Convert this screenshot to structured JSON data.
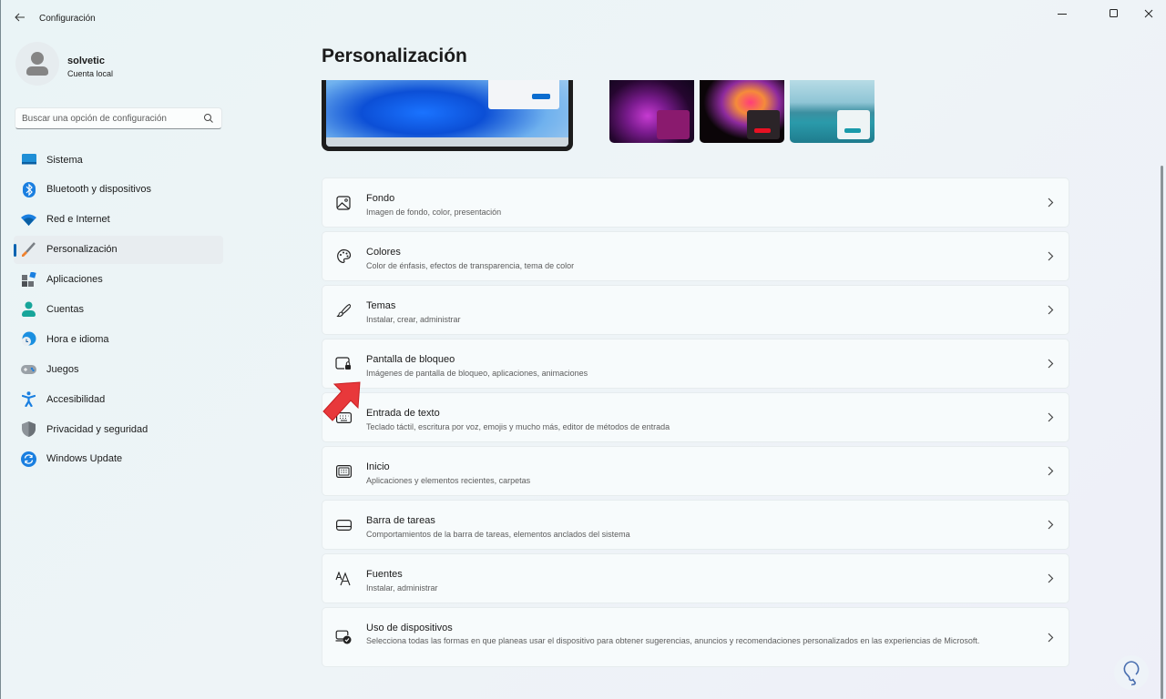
{
  "window": {
    "title": "Configuración",
    "controls": {
      "minimize": "minimize-icon",
      "maximize": "maximize-icon",
      "close": "close-icon"
    }
  },
  "profile": {
    "name": "solvetic",
    "account_type": "Cuenta local"
  },
  "search": {
    "placeholder": "Buscar una opción de configuración",
    "value": ""
  },
  "sidebar": {
    "active_index": 3,
    "accent_color": "#0063b1",
    "items": [
      {
        "label": "Sistema",
        "icon": "monitor-icon"
      },
      {
        "label": "Bluetooth y dispositivos",
        "icon": "bluetooth-icon"
      },
      {
        "label": "Red e Internet",
        "icon": "wifi-icon"
      },
      {
        "label": "Personalización",
        "icon": "paintbrush-icon"
      },
      {
        "label": "Aplicaciones",
        "icon": "apps-icon"
      },
      {
        "label": "Cuentas",
        "icon": "person-icon"
      },
      {
        "label": "Hora e idioma",
        "icon": "globe-clock-icon"
      },
      {
        "label": "Juegos",
        "icon": "gamepad-icon"
      },
      {
        "label": "Accesibilidad",
        "icon": "accessibility-icon"
      },
      {
        "label": "Privacidad y seguridad",
        "icon": "shield-icon"
      },
      {
        "label": "Windows Update",
        "icon": "update-icon"
      }
    ]
  },
  "main": {
    "title": "Personalización",
    "themes": [
      {
        "name": "theme-1",
        "selected": true
      },
      {
        "name": "theme-2",
        "selected": false
      },
      {
        "name": "theme-3",
        "selected": false
      },
      {
        "name": "theme-4",
        "selected": false,
        "button_color": "#8a1a6e"
      },
      {
        "name": "theme-5",
        "selected": false,
        "button_color": "#e81123"
      },
      {
        "name": "theme-6",
        "selected": false,
        "button_color": "#1a9aaa"
      }
    ],
    "settings": [
      {
        "title": "Fondo",
        "description": "Imagen de fondo, color, presentación",
        "icon": "image-icon"
      },
      {
        "title": "Colores",
        "description": "Color de énfasis, efectos de transparencia, tema de color",
        "icon": "palette-icon"
      },
      {
        "title": "Temas",
        "description": "Instalar, crear, administrar",
        "icon": "brush-icon"
      },
      {
        "title": "Pantalla de bloqueo",
        "description": "Imágenes de pantalla de bloqueo, aplicaciones, animaciones",
        "icon": "lock-screen-icon"
      },
      {
        "title": "Entrada de texto",
        "description": "Teclado táctil, escritura por voz, emojis y mucho más, editor de métodos de entrada",
        "icon": "keyboard-icon"
      },
      {
        "title": "Inicio",
        "description": "Aplicaciones y elementos recientes, carpetas",
        "icon": "start-icon"
      },
      {
        "title": "Barra de tareas",
        "description": "Comportamientos de la barra de tareas, elementos anclados del sistema",
        "icon": "taskbar-icon"
      },
      {
        "title": "Fuentes",
        "description": "Instalar, administrar",
        "icon": "fonts-icon"
      },
      {
        "title": "Uso de dispositivos",
        "description": "Selecciona todas las formas en que planeas usar el dispositivo para obtener sugerencias, anuncios y recomendaciones personalizados en las experiencias de Microsoft.",
        "icon": "device-usage-icon"
      }
    ]
  },
  "annotation": {
    "arrow_color": "#e8383b",
    "points_to": "Pantalla de bloqueo"
  }
}
